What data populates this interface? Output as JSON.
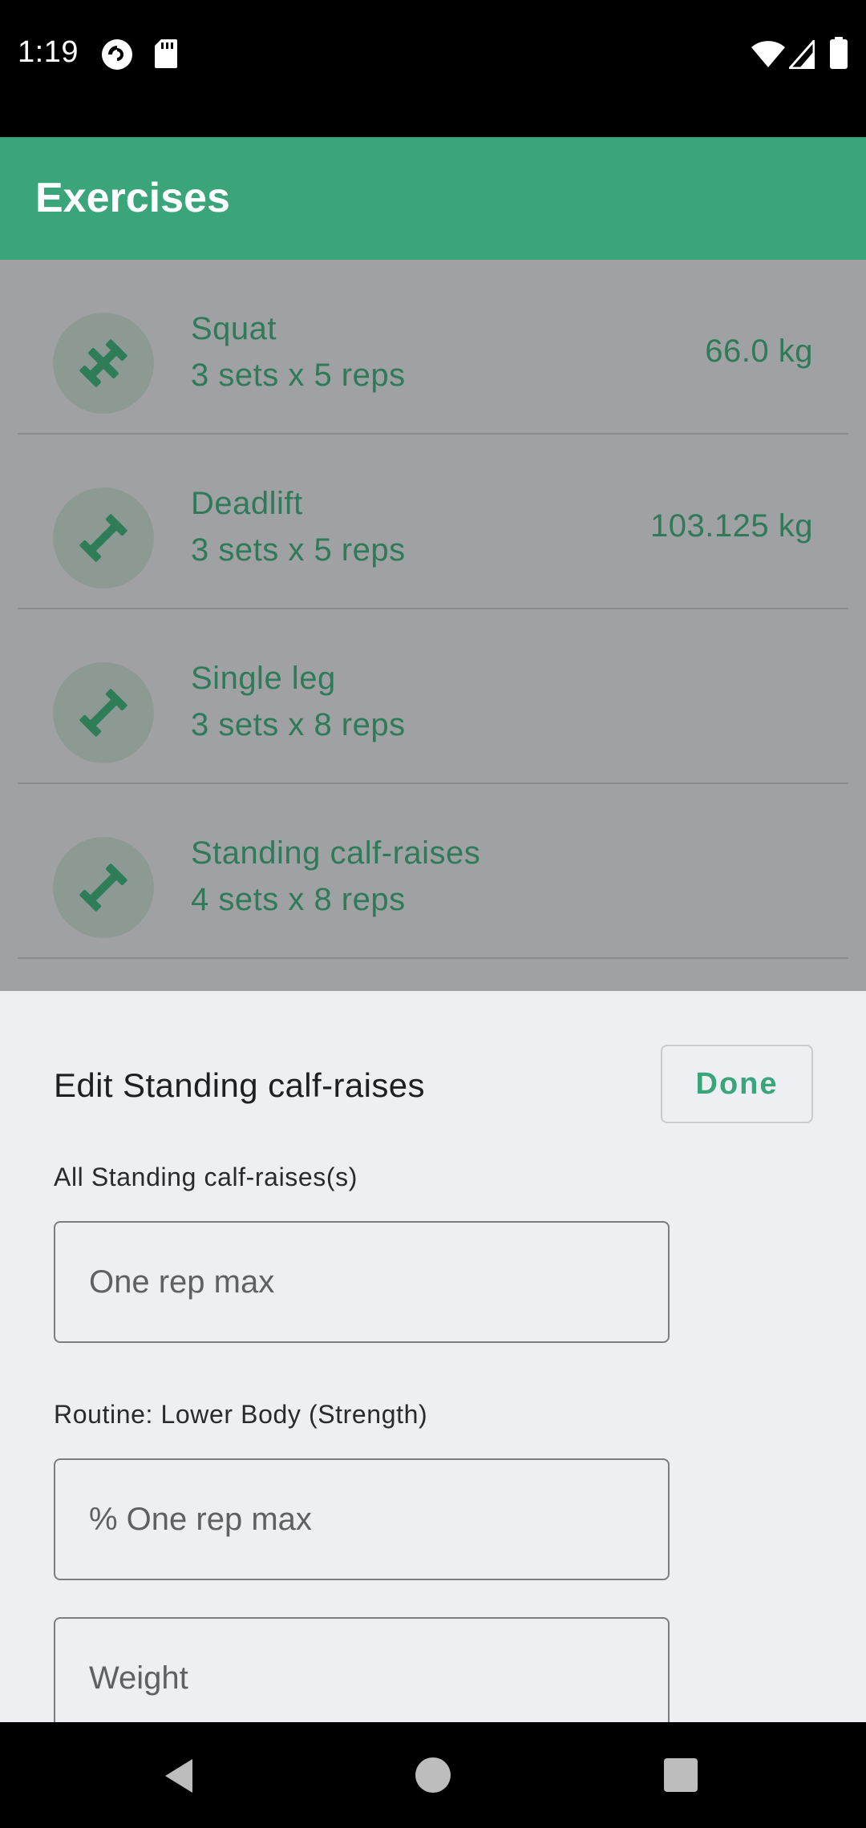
{
  "status_bar": {
    "time": "1:19",
    "left_icons": [
      "pocket-casts-icon",
      "sd-card-icon"
    ],
    "right_icons": [
      "wifi-icon",
      "cell-signal-icon",
      "battery-icon"
    ]
  },
  "app_bar": {
    "title": "Exercises"
  },
  "exercises": [
    {
      "name": "Squat",
      "sets": "3 sets x 5 reps",
      "weight": "66.0 kg",
      "icon": "dumbbell-icon"
    },
    {
      "name": "Deadlift",
      "sets": "3 sets x 5 reps",
      "weight": "103.125 kg",
      "icon": "dumbbell-icon"
    },
    {
      "name": "Single leg",
      "sets": "3 sets x 8 reps",
      "weight": "",
      "icon": "dumbbell-icon"
    },
    {
      "name": "Standing calf-raises",
      "sets": "4 sets x 8 reps",
      "weight": "",
      "icon": "dumbbell-icon"
    }
  ],
  "sheet": {
    "title": "Edit Standing calf-raises",
    "done_label": "Done",
    "all_label": "All Standing calf-raises(s)",
    "one_rep_max_placeholder": "One rep max",
    "routine_label": "Routine:  Lower Body (Strength)",
    "percent_placeholder": "% One rep max",
    "weight_placeholder": "Weight"
  },
  "colors": {
    "accent": "#3aa57b",
    "scrim_list": "#a0a1a3",
    "sheet_bg": "#eeeff3"
  },
  "nav_bar": {
    "icons": [
      "back-icon",
      "home-icon",
      "recents-icon"
    ]
  }
}
